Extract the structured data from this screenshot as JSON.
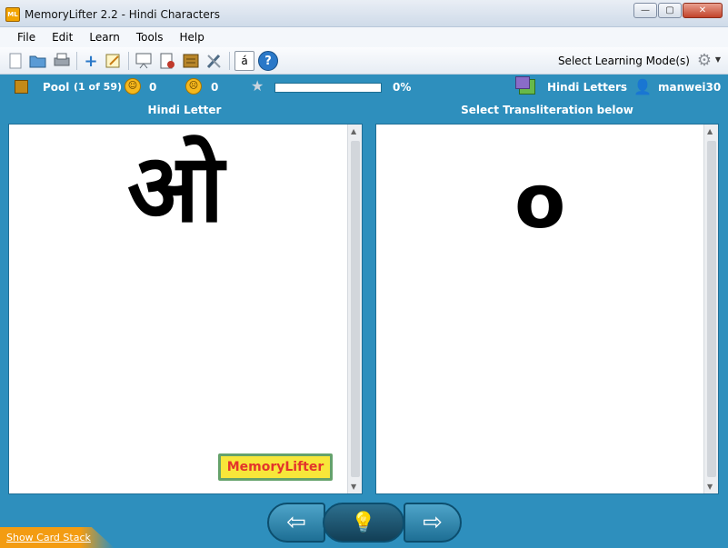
{
  "window": {
    "title": "MemoryLifter 2.2 - Hindi Characters",
    "icon_text": "ML",
    "controls": [
      "—",
      "▢",
      "✕"
    ]
  },
  "menu": [
    "File",
    "Edit",
    "Learn",
    "Tools",
    "Help"
  ],
  "toolbar": {
    "icons": [
      "new-icon",
      "open-icon",
      "print-icon",
      "add-card-icon",
      "edit-icon",
      "presentation-icon",
      "statistics-icon",
      "card-box-icon",
      "settings-tools-icon",
      "special-char-icon",
      "help-icon"
    ],
    "special_char_glyph": "á",
    "help_glyph": "?",
    "learning_mode_label": "Select Learning Mode(s)"
  },
  "status": {
    "pool_label": "Pool",
    "pool_count": "(1 of 59)",
    "good_count": "0",
    "bad_count": "0",
    "progress_percent": "0%",
    "progress_fraction": 0,
    "deck_name": "Hindi Letters",
    "username": "manwei30"
  },
  "panels": {
    "question_header": "Hindi Letter",
    "answer_header": "Select Transliteration below",
    "question_char": "ओ",
    "answer_char": "o",
    "logo_text": "MemoryLifter"
  },
  "footer": {
    "show_card_stack": "Show Card Stack",
    "prev_glyph": "⇦",
    "next_glyph": "⇨",
    "hint_glyph": "💡"
  }
}
